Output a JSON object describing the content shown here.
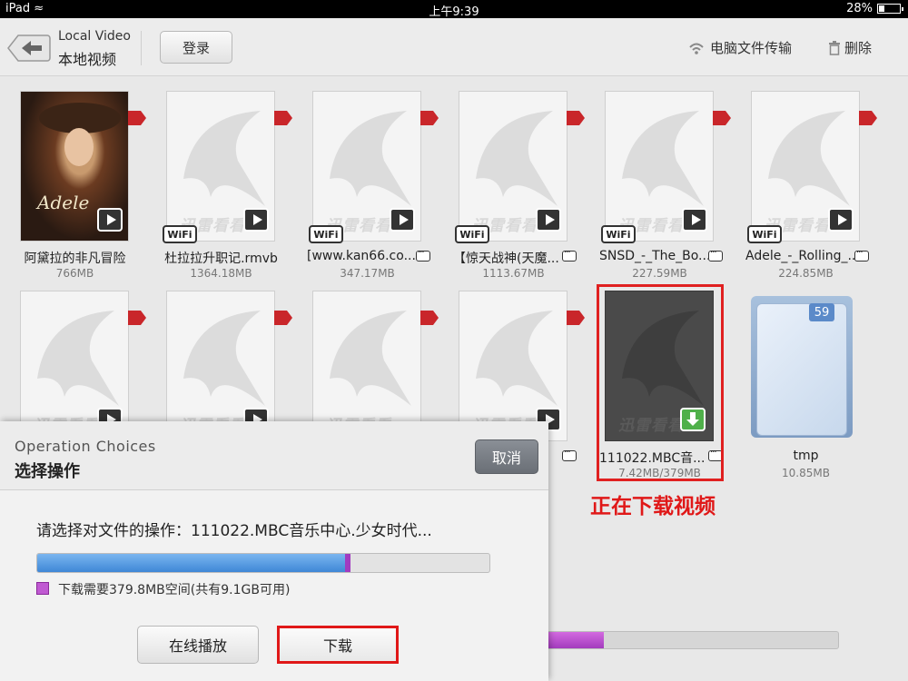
{
  "status_bar": {
    "device": "iPad",
    "time": "上午9:39",
    "battery": "28%",
    "battery_level": 0.28
  },
  "header": {
    "back_label_en": "Local Video",
    "back_label_cn": "本地视频",
    "login": "登录",
    "pc_transfer": "电脑文件传输",
    "delete": "删除"
  },
  "watermark": "迅雷看看",
  "videos": [
    {
      "name": "阿黛拉的非凡冒险",
      "size": "766MB",
      "poster": true,
      "poster_title": "Adele",
      "flag": true
    },
    {
      "name": "杜拉拉升职记.rmvb",
      "size": "1364.18MB",
      "wifi": "WiFi",
      "flag": true
    },
    {
      "name": "[www.kan66.co...",
      "size": "347.17MB",
      "wifi": "WiFi",
      "flag": true,
      "more": true
    },
    {
      "name": "【惊天战神(天魔...",
      "size": "1113.67MB",
      "wifi": "WiFi",
      "flag": true,
      "more": true
    },
    {
      "name": "SNSD_-_The_Bo...",
      "size": "227.59MB",
      "wifi": "WiFi",
      "flag": true,
      "more": true
    },
    {
      "name": "Adele_-_Rolling_...",
      "size": "224.85MB",
      "wifi": "WiFi",
      "flag": true,
      "more": true
    },
    {
      "name": "",
      "size": "",
      "flag": true
    },
    {
      "name": "",
      "size": "",
      "flag": true
    },
    {
      "name": "",
      "size": "",
      "flag": true
    },
    {
      "name": "",
      "size": "",
      "flag": true,
      "more": true
    },
    {
      "name": "111022.MBC音...",
      "size": "7.42MB/379MB",
      "downloading": true,
      "more": true
    }
  ],
  "folder": {
    "name": "tmp",
    "size": "10.85MB",
    "count": "59"
  },
  "annotation": {
    "downloading_label": "正在下载视频",
    "color": "#e01818"
  },
  "background_progress": {
    "value": 0.21
  },
  "dialog": {
    "title_en": "Operation Choices",
    "title_cn": "选择操作",
    "cancel": "取消",
    "message": "请选择对文件的操作：111022.MBC音乐中心.少女时代...",
    "progress_used": 0.68,
    "legend": "下载需要379.8MB空间(共有9.1GB可用)",
    "online_play": "在线播放",
    "download": "下载"
  }
}
